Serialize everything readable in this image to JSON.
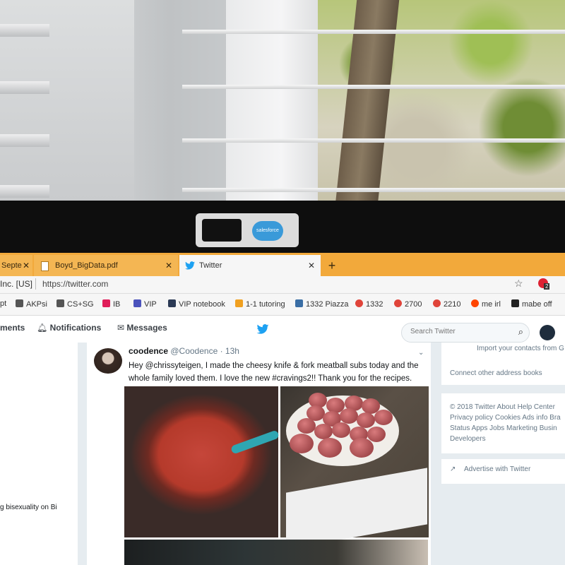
{
  "browser": {
    "tabs": [
      {
        "label": "Septe",
        "active": false
      },
      {
        "label": "Boyd_BigData.pdf",
        "active": false
      },
      {
        "label": "Twitter",
        "active": true
      }
    ],
    "close_glyph": "✕",
    "new_tab_glyph": "+",
    "cert_label": "Inc. [US]",
    "url": "https://twitter.com",
    "extension_badge_count": "2"
  },
  "bookmarks": [
    {
      "label": "AKPsi",
      "icon": "hashtag-icon",
      "color": "#555555"
    },
    {
      "label": "CS+SG",
      "icon": "hashtag-icon",
      "color": "#555555"
    },
    {
      "label": "IB",
      "icon": "slack-icon",
      "color": "#e01e5a"
    },
    {
      "label": "VIP",
      "icon": "teams-icon",
      "color": "#4b53bc"
    },
    {
      "label": "VIP notebook",
      "icon": "cube-icon",
      "color": "#2b3a55"
    },
    {
      "label": "1-1 tutoring",
      "icon": "burst-icon",
      "color": "#f0a020"
    },
    {
      "label": "1332 Piazza",
      "icon": "piazza-icon",
      "color": "#3a6ea5"
    },
    {
      "label": "1332",
      "icon": "pinwheel-icon",
      "color": "#e0443a"
    },
    {
      "label": "2700",
      "icon": "pinwheel-icon",
      "color": "#e0443a"
    },
    {
      "label": "2210",
      "icon": "pinwheel-icon",
      "color": "#e0443a"
    },
    {
      "label": "me irl",
      "icon": "reddit-icon",
      "color": "#ff4500"
    },
    {
      "label": "mabe off",
      "icon": "book-icon",
      "color": "#222222"
    }
  ],
  "nav": {
    "moments_partial": "ments",
    "notifications": "Notifications",
    "messages": "Messages",
    "search_placeholder": "Search Twitter"
  },
  "left_column": {
    "trend_text": "g bisexuality on Bi"
  },
  "tweet": {
    "name": "coodence",
    "handle": "@Coodence",
    "time": "· 13h",
    "text": "Hey @chrissyteigen, I made the cheesy knife & fork meatball subs today and the whole family loved them. I love the new #cravings2!! Thank you for the recipes."
  },
  "sidebar": {
    "import_contacts": "Import your contacts from G",
    "connect_address_books": "Connect other address books",
    "footer_lines": [
      "© 2018 Twitter  About  Help Center",
      "Privacy policy  Cookies  Ads info  Bra",
      "Status  Apps  Jobs  Marketing  Busin",
      "Developers"
    ],
    "advertise": "Advertise with Twitter"
  },
  "colors": {
    "tab_strip": "#f2a93b",
    "twitter_blue": "#1da1f2"
  }
}
